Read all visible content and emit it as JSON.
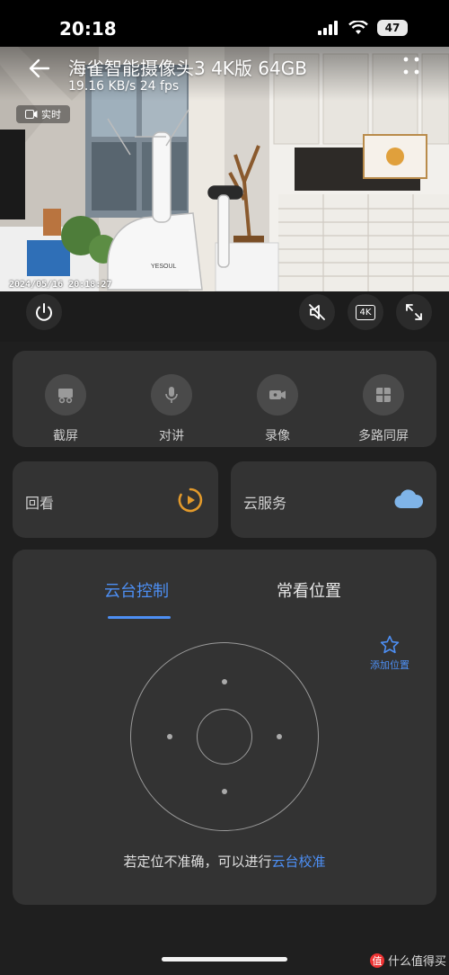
{
  "status_bar": {
    "time": "20:18",
    "battery": "47"
  },
  "camera": {
    "title": "海雀智能摄像头3 4K版 64GB",
    "rate": "19.16 KB/s  24 fps",
    "live_badge": "实时",
    "timestamp": "2024/05/16 20:18:27",
    "brand_logo": "YESOUL"
  },
  "controls": {
    "quality": "4K"
  },
  "tools": [
    {
      "label": "截屏",
      "icon": "screenshot-icon"
    },
    {
      "label": "对讲",
      "icon": "microphone-icon"
    },
    {
      "label": "录像",
      "icon": "video-record-icon"
    },
    {
      "label": "多路同屏",
      "icon": "multi-view-icon"
    }
  ],
  "playback": {
    "label": "回看"
  },
  "cloud": {
    "label": "云服务"
  },
  "ptz": {
    "tab_control": "云台控制",
    "tab_positions": "常看位置",
    "add_position": "添加位置",
    "hint_prefix": "若定位不准确，可以进行",
    "hint_link": "云台校准"
  },
  "watermark": {
    "badge": "值",
    "text": "什么值得买"
  },
  "colors": {
    "accent": "#4d8ff4",
    "playback_accent": "#e39a2b",
    "cloud": "#7fb4e8"
  }
}
